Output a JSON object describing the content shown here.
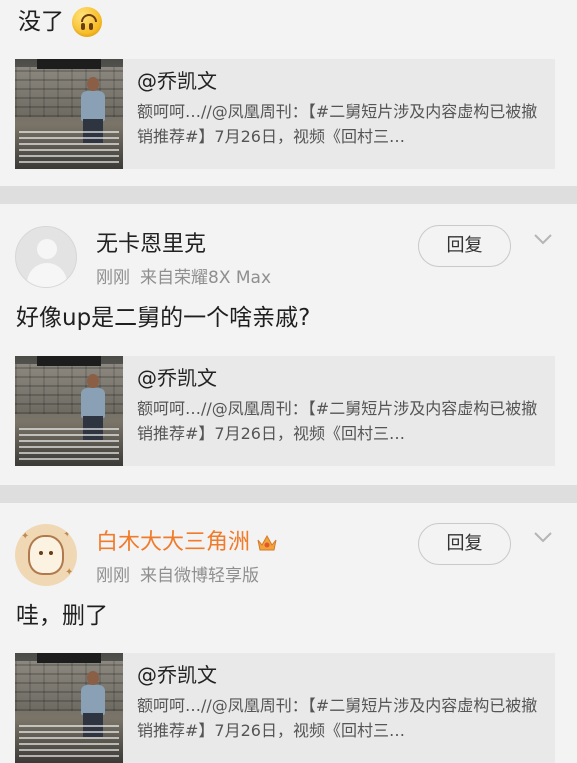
{
  "top_comment": {
    "text": "没了",
    "emoji": "upside-down-face-emoji",
    "repost": {
      "user": "@乔凯文",
      "snippet": "额呵呵…//@凤凰周刊：【#二舅短片涉及内容虚构已被撤销推荐#】7月26日，视频《回村三…"
    }
  },
  "comments": [
    {
      "username": "无卡恩里克",
      "time": "刚刚",
      "source": "来自荣耀8X Max",
      "reply_label": "回复",
      "text": "好像up是二舅的一个啥亲戚?",
      "avatar": "default-avatar",
      "repost": {
        "user": "@乔凯文",
        "snippet": "额呵呵…//@凤凰周刊：【#二舅短片涉及内容虚构已被撤销推荐#】7月26日，视频《回村三…"
      }
    },
    {
      "username": "白木大大三角洲",
      "name_color": "#f07b2a",
      "badge": "crown-badge-icon",
      "time": "刚刚",
      "source": "来自微博轻享版",
      "reply_label": "回复",
      "text": "哇，删了",
      "avatar": "cartoon-avatar",
      "repost": {
        "user": "@乔凯文",
        "snippet": "额呵呵…//@凤凰周刊：【#二舅短片涉及内容虚构已被撤销推荐#】7月26日，视频《回村三…"
      }
    }
  ],
  "colors": {
    "background": "#f3f3f3",
    "card": "#e9e9e9",
    "divider": "#dedede",
    "meta_text": "#8f8f8f",
    "vip_name": "#f07b2a"
  }
}
